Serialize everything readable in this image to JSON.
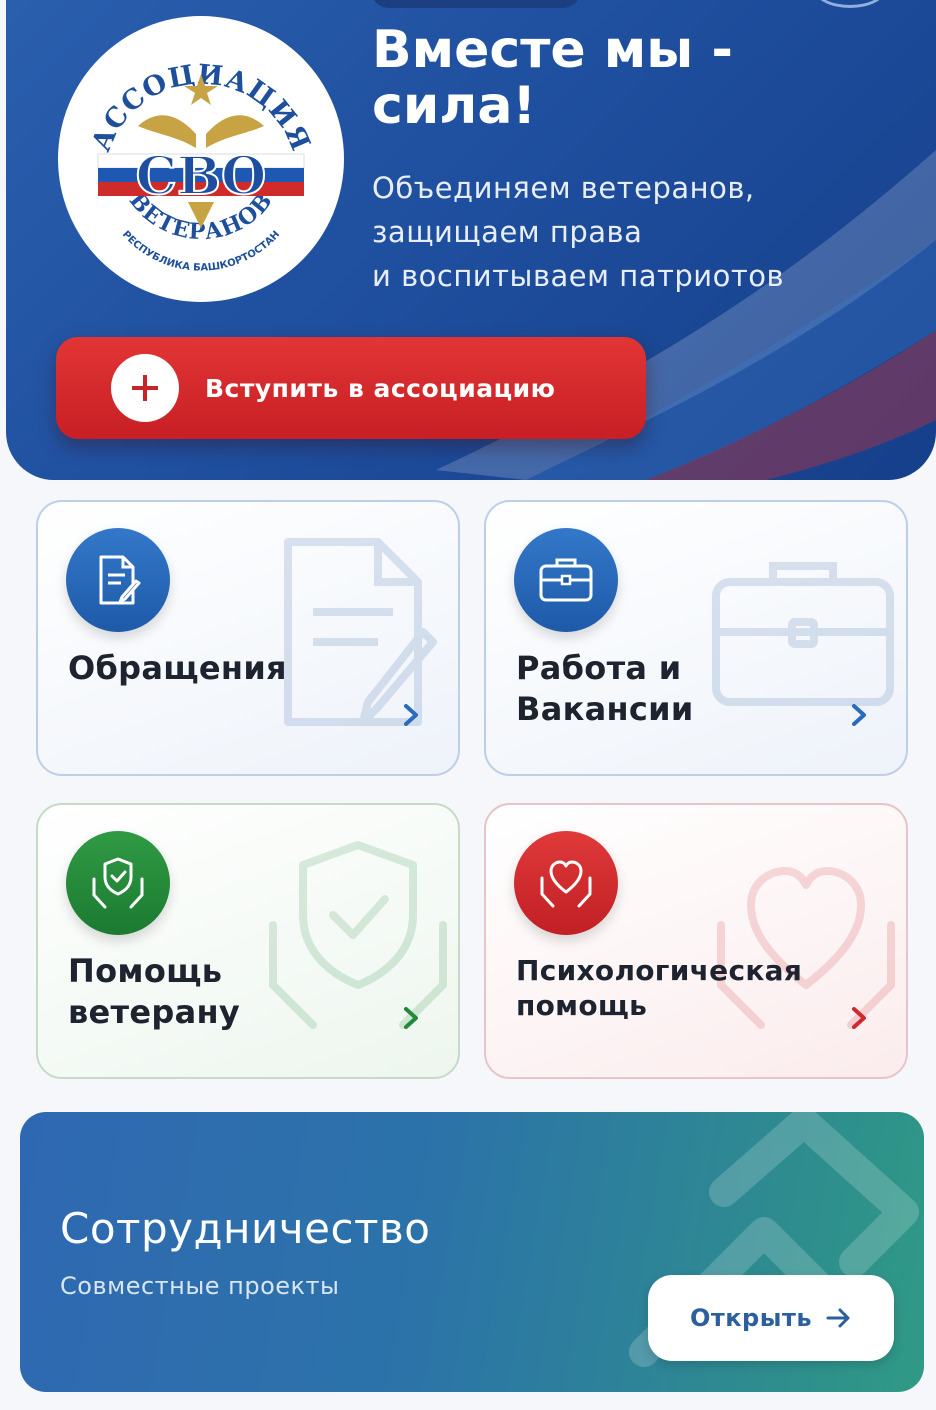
{
  "hero": {
    "title_line1": "Вместе мы -",
    "title_line2": "сила!",
    "subtitle_line1": "Объединяем ветеранов,",
    "subtitle_line2": "защищаем права",
    "subtitle_line3": "и воспитываем патриотов",
    "join_label": "Вступить в ассоциацию"
  },
  "logo": {
    "top_text": "АССОЦИАЦИЯ",
    "center_text": "СВО",
    "bottom_text": "ВЕТЕРАНОВ",
    "region_text": "РЕСПУБЛИКА БАШКОРТОСТАН"
  },
  "cards": [
    {
      "title_line1": "Обращения",
      "title_line2": "",
      "icon": "document-edit-icon",
      "color": "#2a6bbd"
    },
    {
      "title_line1": "Работа и",
      "title_line2": "Вакансии",
      "icon": "briefcase-icon",
      "color": "#2a6bbd"
    },
    {
      "title_line1": "Помощь",
      "title_line2": "ветерану",
      "icon": "shield-hands-icon",
      "color": "#238a3a"
    },
    {
      "title_line1": "Психологическая",
      "title_line2": "помощь",
      "icon": "heart-hands-icon",
      "color": "#cf2a2e"
    }
  ],
  "cooperation": {
    "title": "Сотрудничество",
    "subtitle": "Совместные проекты",
    "button_label": "Открыть"
  }
}
